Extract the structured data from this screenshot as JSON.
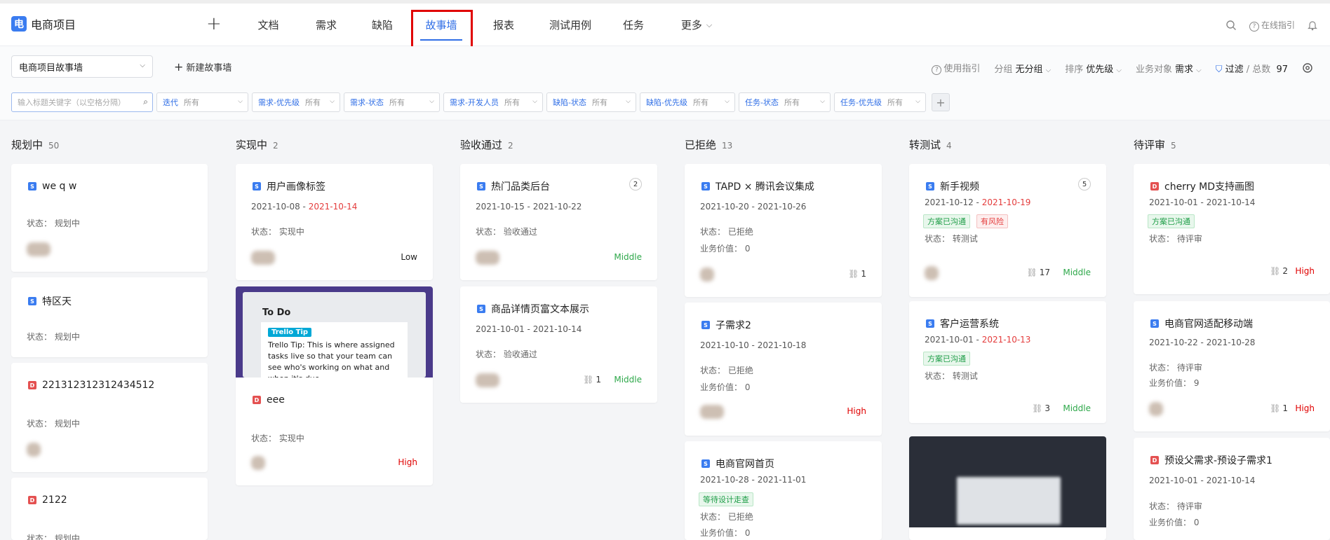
{
  "app": {
    "logo_char": "电",
    "name": "电商项目"
  },
  "nav": {
    "plus": "+",
    "tabs": [
      {
        "label": "文档"
      },
      {
        "label": "需求"
      },
      {
        "label": "缺陷"
      },
      {
        "label": "故事墙",
        "active": true
      },
      {
        "label": "报表"
      },
      {
        "label": "测试用例"
      },
      {
        "label": "任务"
      },
      {
        "label": "更多"
      }
    ],
    "more_chevron": "⌵",
    "guide": "在线指引"
  },
  "toolbar": {
    "wall_select": "电商项目故事墙",
    "new_wall": "新建故事墙",
    "help": "使用指引",
    "group_label": "分组",
    "group_value": "无分组",
    "sort_label": "排序",
    "sort_value": "优先级",
    "object_label": "业务对象",
    "object_value": "需求",
    "filter": "过滤",
    "total_label": "总数",
    "total": "97"
  },
  "filters": {
    "keyword_placeholder": "输入标题关键字（以空格分隔）",
    "chips": [
      {
        "key": "迭代",
        "value": "所有"
      },
      {
        "key": "需求-优先级",
        "value": "所有"
      },
      {
        "key": "需求-状态",
        "value": "所有"
      },
      {
        "key": "需求-开发人员",
        "value": "所有"
      },
      {
        "key": "缺陷-状态",
        "value": "所有"
      },
      {
        "key": "缺陷-优先级",
        "value": "所有"
      },
      {
        "key": "任务-状态",
        "value": "所有"
      },
      {
        "key": "任务-优先级",
        "value": "所有"
      }
    ]
  },
  "columns": [
    {
      "name": "规划中",
      "count": "50"
    },
    {
      "name": "实现中",
      "count": "2"
    },
    {
      "name": "验收通过",
      "count": "2"
    },
    {
      "name": "已拒绝",
      "count": "13"
    },
    {
      "name": "转测试",
      "count": "4"
    },
    {
      "name": "待评审",
      "count": "5"
    }
  ],
  "cards": {
    "c1_1": {
      "type": "S",
      "title": "we q w",
      "status": "状态： 规划中"
    },
    "c1_2": {
      "type": "S",
      "title": "特区天",
      "status": "状态： 规划中"
    },
    "c1_3": {
      "type": "D",
      "title": "221312312312434512",
      "status": "状态： 规划中"
    },
    "c1_4": {
      "type": "D",
      "title": "2122",
      "status": "状态： 规划中"
    },
    "c2_1": {
      "type": "S",
      "title": "用户画像标签",
      "date_start": "2021-10-08 - ",
      "date_end": "2021-10-14",
      "status": "状态： 实现中",
      "priority": "Low"
    },
    "c2_2": {
      "type": "D",
      "title": "eee",
      "status": "状态： 实现中",
      "priority": "High",
      "cover_title": "To Do",
      "cover_tip": "Trello Tip",
      "cover_text": "Trello Tip: This is where assigned tasks live so that your team can see who's working on what and when it's due."
    },
    "c3_1": {
      "type": "S",
      "title": "热门品类后台",
      "badge": "2",
      "date": "2021-10-15 - 2021-10-22",
      "status": "状态： 验收通过",
      "priority": "Middle"
    },
    "c3_2": {
      "type": "S",
      "title": "商品详情页富文本展示",
      "date": "2021-10-01 - 2021-10-14",
      "status": "状态： 验收通过",
      "sub": "1",
      "priority": "Middle"
    },
    "c4_1": {
      "type": "S",
      "title": "TAPD × 腾讯会议集成",
      "date": "2021-10-20 - 2021-10-26",
      "status": "状态： 已拒绝",
      "value": "业务价值： 0",
      "sub": "1"
    },
    "c4_2": {
      "type": "S",
      "title": "子需求2",
      "date": "2021-10-10 - 2021-10-18",
      "status": "状态： 已拒绝",
      "value": "业务价值： 0",
      "priority": "High"
    },
    "c4_3": {
      "type": "S",
      "title": "电商官网首页",
      "date": "2021-10-28 - 2021-11-01",
      "tag": "等待设计走查",
      "status": "状态： 已拒绝",
      "value": "业务价值： 0"
    },
    "c5_1": {
      "type": "S",
      "title": "新手视频",
      "badge": "5",
      "date_start": "2021-10-12 - ",
      "date_end": "2021-10-19",
      "tag1": "方案已沟通",
      "tag2": "有风险",
      "status": "状态： 转测试",
      "sub": "17",
      "priority": "Middle"
    },
    "c5_2": {
      "type": "S",
      "title": "客户运营系统",
      "date_start": "2021-10-01 - ",
      "date_end": "2021-10-13",
      "tag1": "方案已沟通",
      "status": "状态： 转测试",
      "sub": "3",
      "priority": "Middle"
    },
    "c6_1": {
      "type": "D",
      "title": "cherry MD支持画图",
      "date": "2021-10-01 - 2021-10-14",
      "tag1": "方案已沟通",
      "status": "状态： 待评审",
      "sub": "2",
      "priority": "High"
    },
    "c6_2": {
      "type": "S",
      "title": "电商官网适配移动端",
      "date": "2021-10-22 - 2021-10-28",
      "status": "状态： 待评审",
      "value": "业务价值： 9",
      "sub": "1",
      "priority": "High"
    },
    "c6_3": {
      "type": "D",
      "title": "预设父需求-预设子需求1",
      "date": "2021-10-01 - 2021-10-14",
      "status": "状态： 待评审",
      "value": "业务价值： 0"
    }
  },
  "colors": {
    "accent": "#2f6ee6",
    "story": "#3a7cf0",
    "defect": "#e45151",
    "high": "#e00000",
    "middle": "#2ea84a"
  }
}
